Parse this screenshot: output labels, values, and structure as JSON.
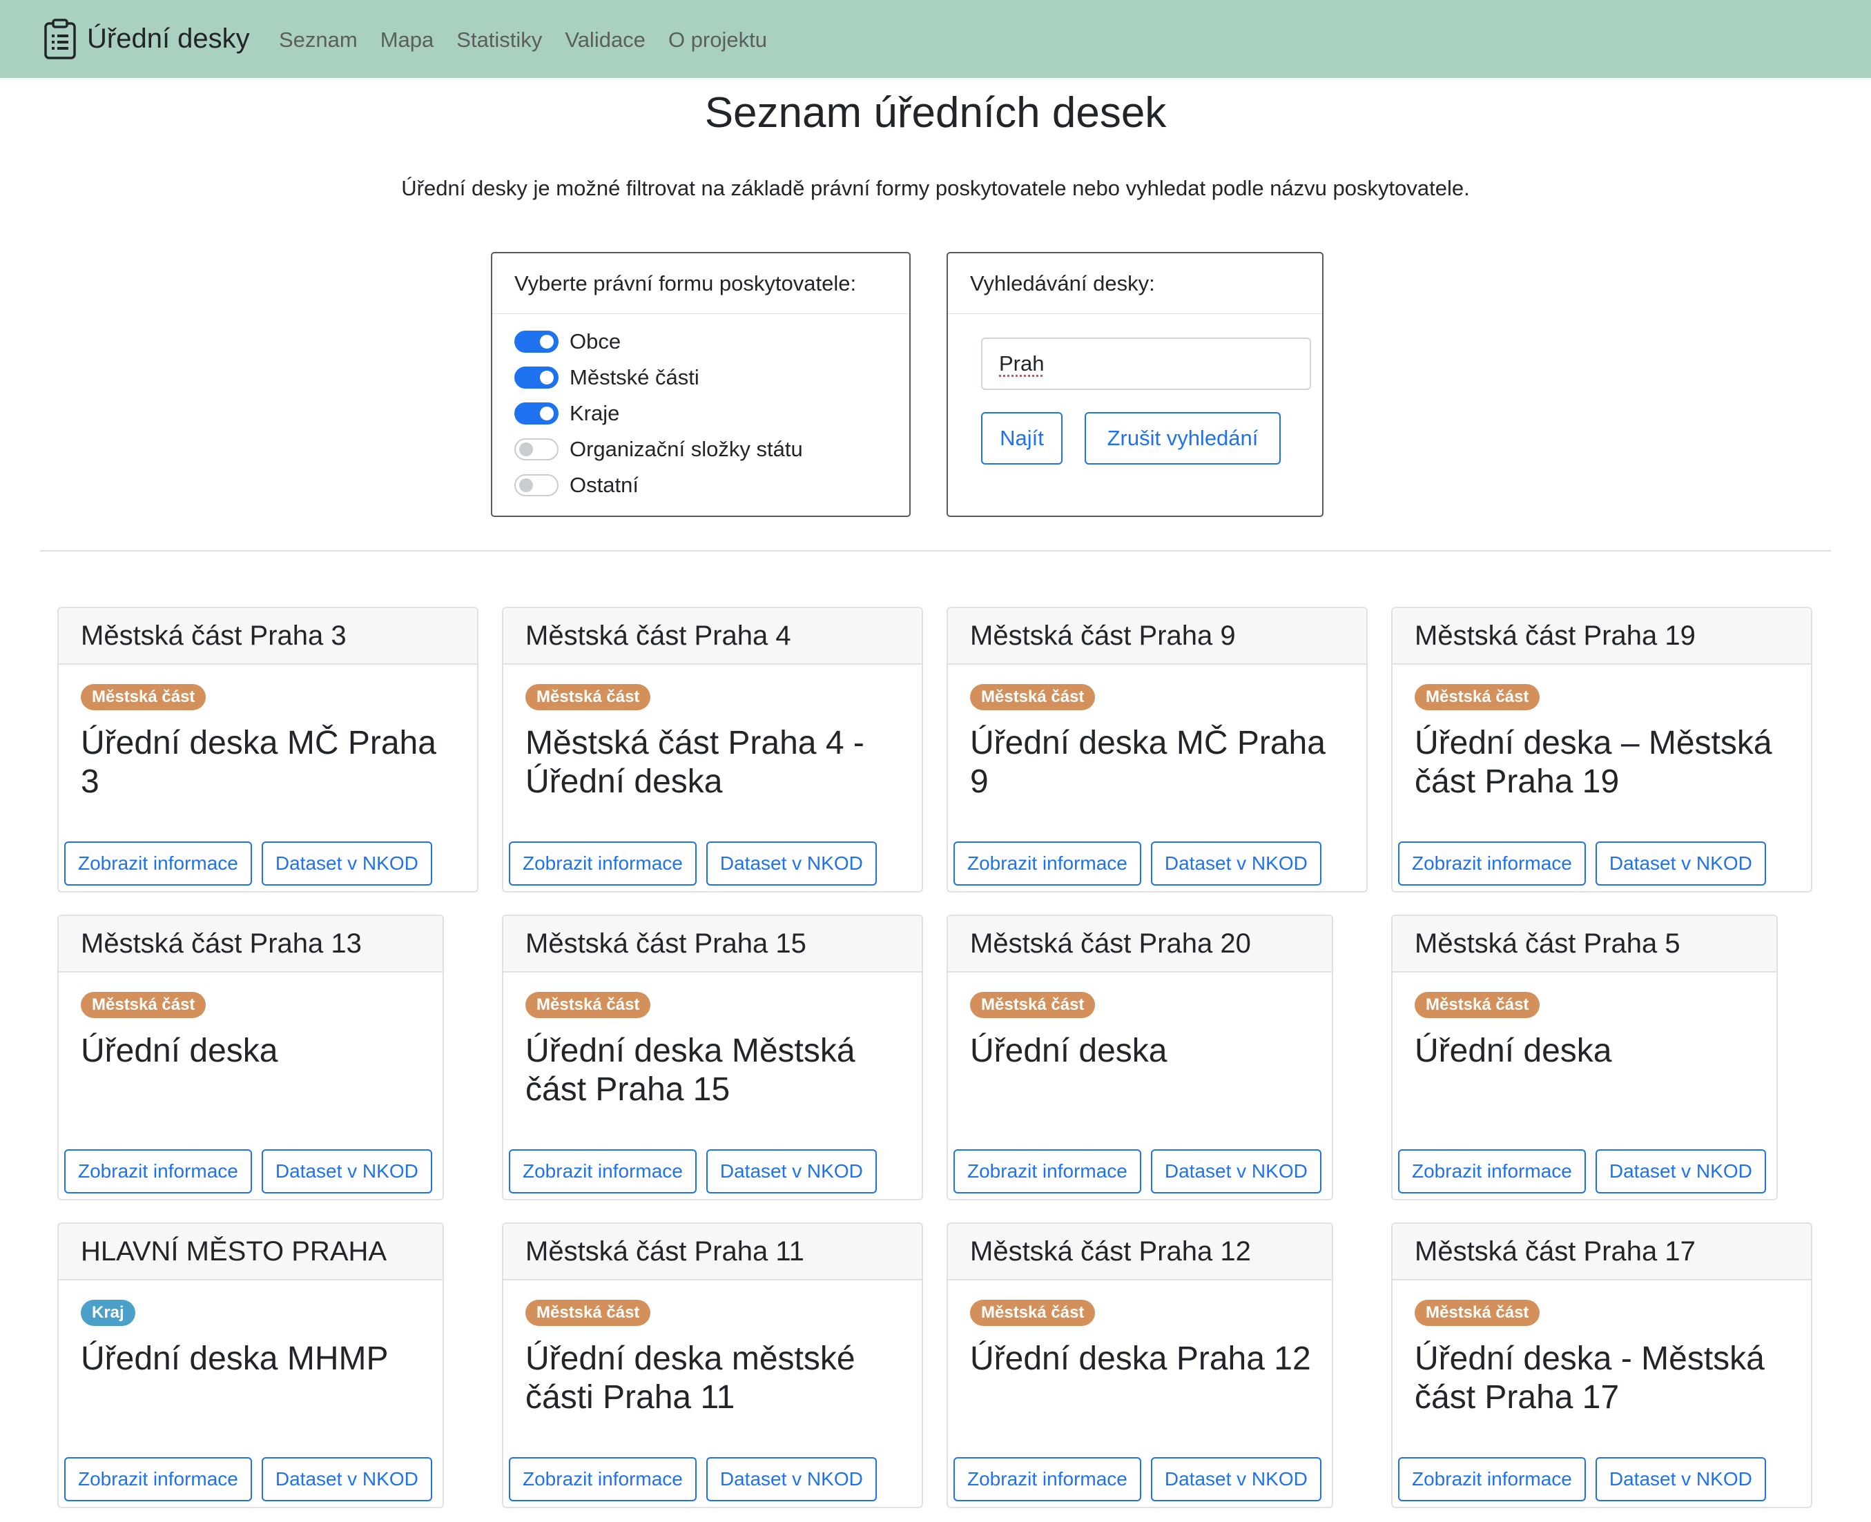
{
  "navbar": {
    "brand": "Úřední desky",
    "brand_icon": "clipboard-list-icon",
    "links": [
      "Seznam",
      "Mapa",
      "Statistiky",
      "Validace",
      "O projektu"
    ]
  },
  "page": {
    "title": "Seznam úředních desek",
    "intro": "Úřední desky je možné filtrovat na základě právní formy poskytovatele nebo vyhledat podle názvu poskytovatele."
  },
  "legal_form_filter": {
    "header": "Vyberte právní formu poskytovatele:",
    "options": [
      {
        "label": "Obce",
        "checked": true
      },
      {
        "label": "Městské části",
        "checked": true
      },
      {
        "label": "Kraje",
        "checked": true
      },
      {
        "label": "Organizační složky státu",
        "checked": false
      },
      {
        "label": "Ostatní",
        "checked": false
      }
    ]
  },
  "search": {
    "header": "Vyhledávání desky:",
    "value": "Prah",
    "find_label": "Najít",
    "clear_label": "Zrušit vyhledání"
  },
  "colors": {
    "navbar": "#aad1bf",
    "primary": "#1e72f0",
    "badge_district": "#d4905a",
    "badge_region": "#4aa0c8"
  },
  "cards": [
    {
      "header": "Městská část Praha 3",
      "badge": "Městská část",
      "badge_type": "district",
      "title": "Úřední deska MČ Praha 3",
      "info_label": "Zobrazit informace",
      "nkod_label": "Dataset v NKOD"
    },
    {
      "header": "Městská část Praha 4",
      "badge": "Městská část",
      "badge_type": "district",
      "title": "Městská část Praha 4 - Úřední deska",
      "info_label": "Zobrazit informace",
      "nkod_label": "Dataset v NKOD"
    },
    {
      "header": "Městská část Praha 9",
      "badge": "Městská část",
      "badge_type": "district",
      "title": "Úřední deska MČ Praha 9",
      "info_label": "Zobrazit informace",
      "nkod_label": "Dataset v NKOD"
    },
    {
      "header": "Městská část Praha 19",
      "badge": "Městská část",
      "badge_type": "district",
      "title": "Úřední deska – Městská část Praha 19",
      "info_label": "Zobrazit informace",
      "nkod_label": "Dataset v NKOD"
    },
    {
      "header": "Městská část Praha 13",
      "badge": "Městská část",
      "badge_type": "district",
      "title": "Úřední deska",
      "info_label": "Zobrazit informace",
      "nkod_label": "Dataset v NKOD"
    },
    {
      "header": "Městská část Praha 15",
      "badge": "Městská část",
      "badge_type": "district",
      "title": "Úřední deska Městská část Praha 15",
      "info_label": "Zobrazit informace",
      "nkod_label": "Dataset v NKOD"
    },
    {
      "header": "Městská část Praha 20",
      "badge": "Městská část",
      "badge_type": "district",
      "title": "Úřední deska",
      "info_label": "Zobrazit informace",
      "nkod_label": "Dataset v NKOD"
    },
    {
      "header": "Městská část Praha 5",
      "badge": "Městská část",
      "badge_type": "district",
      "title": "Úřední deska",
      "info_label": "Zobrazit informace",
      "nkod_label": "Dataset v NKOD"
    },
    {
      "header": "HLAVNÍ MĚSTO PRAHA",
      "badge": "Kraj",
      "badge_type": "region",
      "title": "Úřední deska MHMP",
      "info_label": "Zobrazit informace",
      "nkod_label": "Dataset v NKOD"
    },
    {
      "header": "Městská část Praha 11",
      "badge": "Městská část",
      "badge_type": "district",
      "title": "Úřední deska městské části Praha 11",
      "info_label": "Zobrazit informace",
      "nkod_label": "Dataset v NKOD"
    },
    {
      "header": "Městská část Praha 12",
      "badge": "Městská část",
      "badge_type": "district",
      "title": "Úřední deska Praha 12",
      "info_label": "Zobrazit informace",
      "nkod_label": "Dataset v NKOD"
    },
    {
      "header": "Městská část Praha 17",
      "badge": "Městská část",
      "badge_type": "district",
      "title": "Úřední deska - Městská část Praha 17",
      "info_label": "Zobrazit informace",
      "nkod_label": "Dataset v NKOD"
    }
  ]
}
